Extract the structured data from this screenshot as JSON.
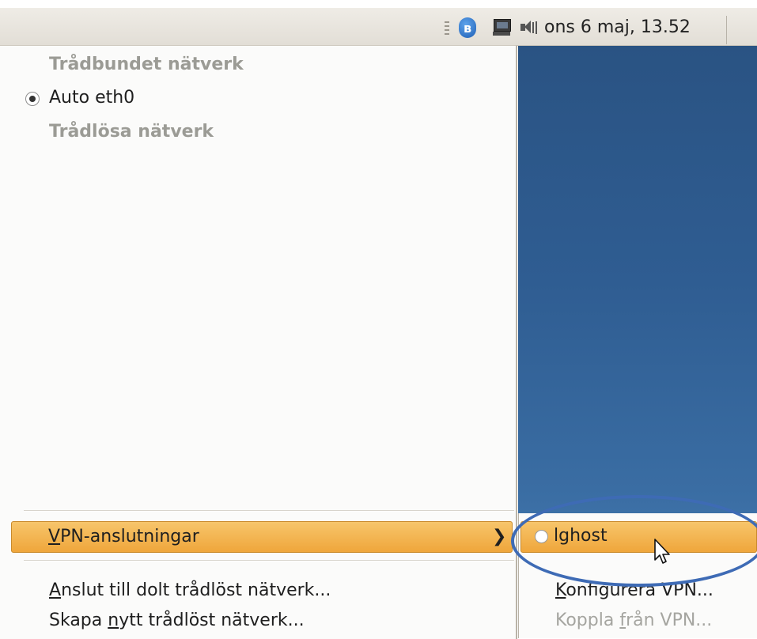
{
  "panel": {
    "clock": "ons  6 maj, 13.52",
    "icons": [
      "bluetooth-icon",
      "network-icon",
      "volume-icon"
    ]
  },
  "menu": {
    "wired_heading": "Trådbundet nätverk",
    "wired_connection": "Auto eth0",
    "wireless_heading": "Trådlösa nätverk",
    "vpn_item": {
      "mnemonic": "V",
      "rest": "PN-anslutningar",
      "arrow": "❯"
    },
    "connect_hidden": {
      "mnemonic": "A",
      "rest": "nslut till dolt trådlöst nätverk..."
    },
    "create_new": {
      "before": "Skapa ",
      "mnemonic": "n",
      "rest": "ytt trådlöst nätverk..."
    }
  },
  "submenu": {
    "vpn_connection": "lghost",
    "configure": {
      "mnemonic": "K",
      "rest": "onfigurera VPN..."
    },
    "disconnect": {
      "before": "Koppla ",
      "mnemonic": "f",
      "rest": "rån VPN..."
    }
  },
  "colors": {
    "highlight": "#efa63b",
    "annotation": "#3e6bb5",
    "wallpaper": "#2f5d92"
  }
}
